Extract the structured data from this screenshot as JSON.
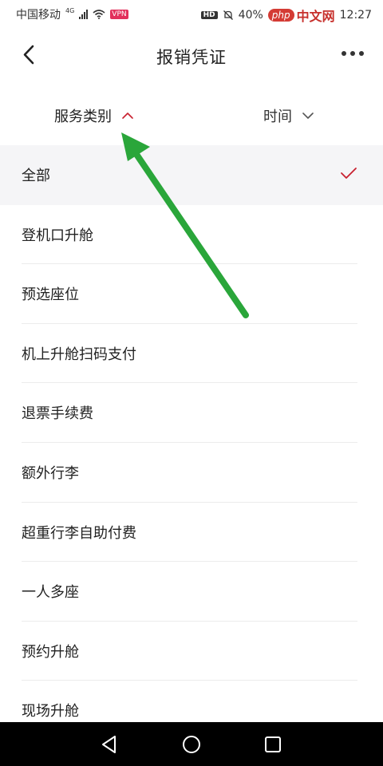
{
  "status_bar": {
    "carrier": "中国移动",
    "network": "4G",
    "vpn_badge": "VPN",
    "hd_badge": "HD",
    "battery": "40%",
    "time": "12:27",
    "watermark_latin": "php",
    "watermark_cn": "中文网"
  },
  "header": {
    "title": "报销凭证",
    "back_icon": "chevron-left-icon",
    "more_icon": "more-horizontal-icon"
  },
  "filters": [
    {
      "label": "服务类别",
      "state": "expanded",
      "chevron": "chevron-up-icon"
    },
    {
      "label": "时间",
      "state": "collapsed",
      "chevron": "chevron-down-icon"
    }
  ],
  "categories": [
    {
      "label": "全部",
      "selected": true
    },
    {
      "label": "登机口升舱"
    },
    {
      "label": "预选座位"
    },
    {
      "label": "机上升舱扫码支付"
    },
    {
      "label": "退票手续费"
    },
    {
      "label": "额外行李"
    },
    {
      "label": "超重行李自助付费"
    },
    {
      "label": "一人多座"
    },
    {
      "label": "预约升舱"
    },
    {
      "label": "现场升舱"
    }
  ],
  "colors": {
    "accent": "#c8202f",
    "annotation_arrow": "#2aa63a",
    "selected_row_bg": "#f5f5f7",
    "nav_bar_bg": "#000000"
  }
}
